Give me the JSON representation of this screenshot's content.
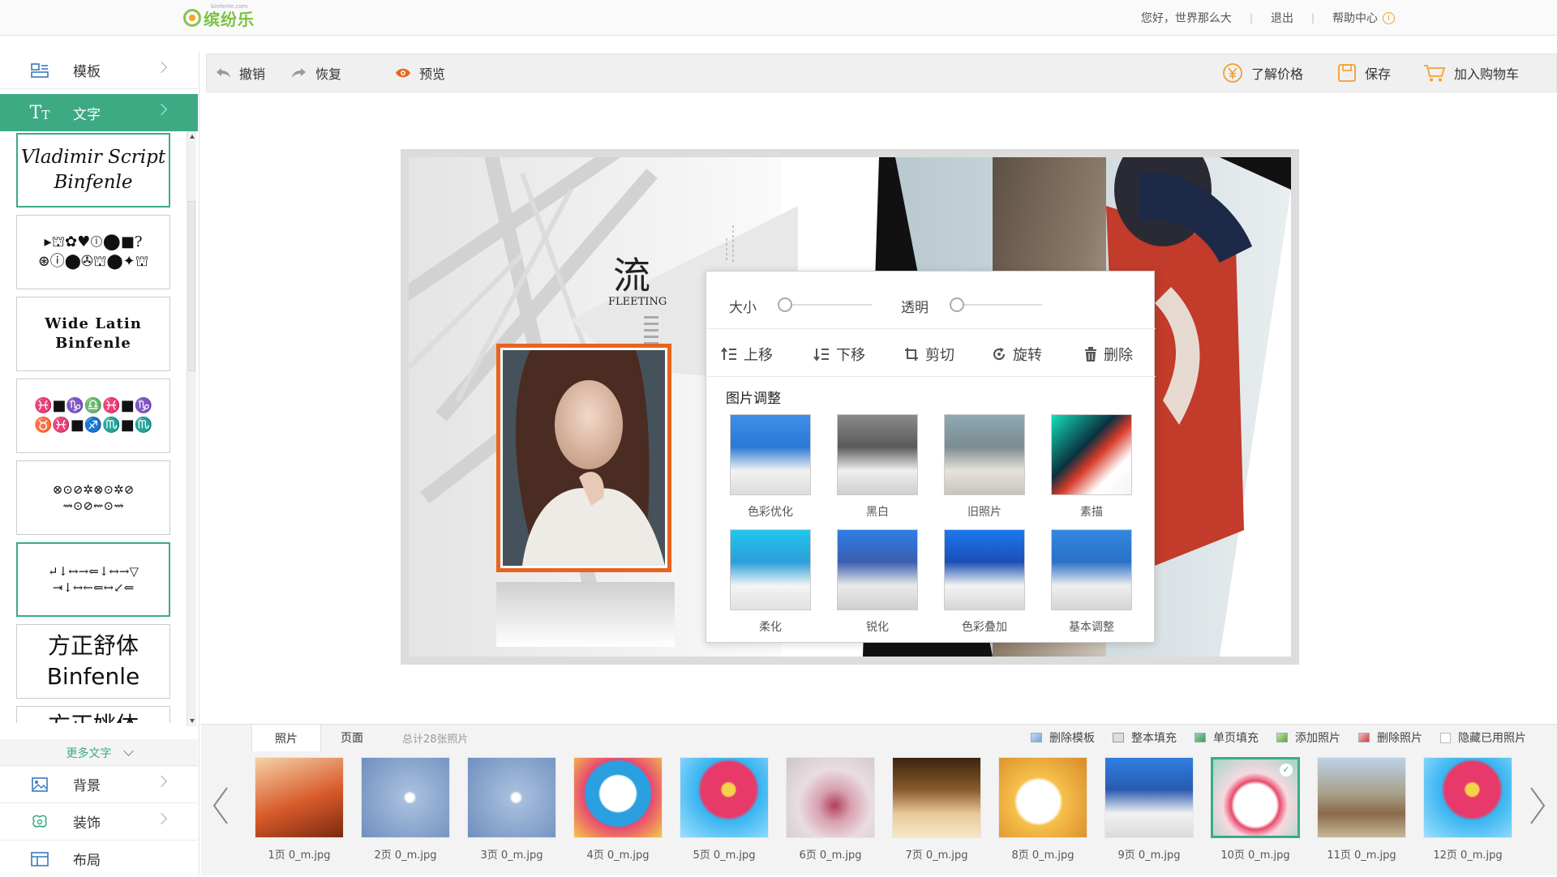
{
  "header": {
    "logo_text": "缤纷乐",
    "logo_sub": "binfenle.com",
    "greeting": "您好，世界那么大",
    "logout": "退出",
    "help": "帮助中心"
  },
  "sidebar": {
    "template": "模板",
    "text": "文字",
    "more_text": "更多文字",
    "background": "背景",
    "decoration": "装饰",
    "layout": "布局",
    "fonts": [
      {
        "l1": "Vladimir Script",
        "l2": "Binfenle"
      },
      {
        "l1": "▸⛫✿♥ⓘ⬤■?",
        "l2": "⊛ⓘ⬤✇⛫⬤✦⛫"
      },
      {
        "l1": "Wide Latin",
        "l2": "Binfenle"
      },
      {
        "l1": "♓■♑♎♓■♑",
        "l2": "♉♓■♐♏■♏"
      },
      {
        "l1": "⊗⊙⊘✲⊗⊙✲⊘",
        "l2": "⇝⊙⊘⇜⊙⇝"
      },
      {
        "l1": "↵↓↔→⇐↓↔→▽",
        "l2": "⇥↓↔←⇐↔↙⇐"
      },
      {
        "l1": "方正舒体",
        "l2": "Binfenle"
      },
      {
        "l1": "方正姚体",
        "l2": ""
      }
    ]
  },
  "toolbar": {
    "undo": "撤销",
    "redo": "恢复",
    "preview": "预览",
    "price": "了解价格",
    "save": "保存",
    "cart": "加入购物车"
  },
  "canvas": {
    "title_char": "流",
    "title_en": "FLEETING"
  },
  "panel": {
    "size": "大小",
    "opacity": "透明",
    "size_level": 0,
    "opacity_level": 0,
    "actions": [
      "上移",
      "下移",
      "剪切",
      "旋转",
      "删除"
    ],
    "adjust_title": "图片调整",
    "filters": [
      "色彩优化",
      "黑白",
      "旧照片",
      "素描",
      "柔化",
      "锐化",
      "色彩叠加",
      "基本调整"
    ]
  },
  "bottom": {
    "tab_photos": "照片",
    "tab_pages": "页面",
    "count": "总计28张照片",
    "actions": [
      "删除模板",
      "整本填充",
      "单页填充",
      "添加照片",
      "删除照片"
    ],
    "hide_used": "隐藏已用照片",
    "photos": [
      "1页 0_m.jpg",
      "2页 0_m.jpg",
      "3页 0_m.jpg",
      "4页 0_m.jpg",
      "5页 0_m.jpg",
      "6页 0_m.jpg",
      "7页 0_m.jpg",
      "8页 0_m.jpg",
      "9页 0_m.jpg",
      "10页 0_m.jpg",
      "11页 0_m.jpg",
      "12页 0_m.jpg"
    ],
    "selected_photo_index": 9
  },
  "colors": {
    "accent": "#3daa84",
    "frame_orange": "#e8641e",
    "price_icon": "#f0a030"
  }
}
